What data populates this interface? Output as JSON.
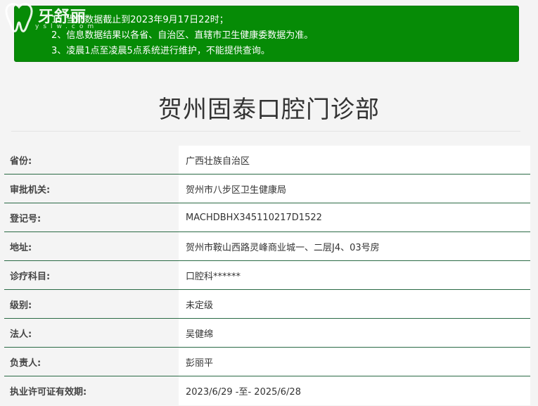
{
  "logo": {
    "text": "牙舒丽",
    "subtext": "yslw.com"
  },
  "notice": {
    "lines": [
      "1、当前数据截止到2023年9月17日22时；",
      "2、信息数据结果以各省、自治区、直辖市卫生健康委数据为准。",
      "3、凌晨1点至凌晨5点系统进行维护，不能提供查询。"
    ]
  },
  "page_title": "贺州固泰口腔门诊部",
  "rows": [
    {
      "label": "省份:",
      "value": "广西壮族自治区"
    },
    {
      "label": "审批机关:",
      "value": "贺州市八步区卫生健康局"
    },
    {
      "label": "登记号:",
      "value": "MACHDBHX345110217D1522"
    },
    {
      "label": "地址:",
      "value": "贺州市鞍山西路灵峰商业城一、二层J4、03号房"
    },
    {
      "label": "诊疗科目:",
      "value": "口腔科******"
    },
    {
      "label": "级别:",
      "value": "未定级"
    },
    {
      "label": "法人:",
      "value": "吴健绵"
    },
    {
      "label": "负责人:",
      "value": "彭丽平"
    },
    {
      "label": "执业许可证有效期:",
      "value": "2023/6/29 -至- 2025/6/28"
    }
  ]
}
